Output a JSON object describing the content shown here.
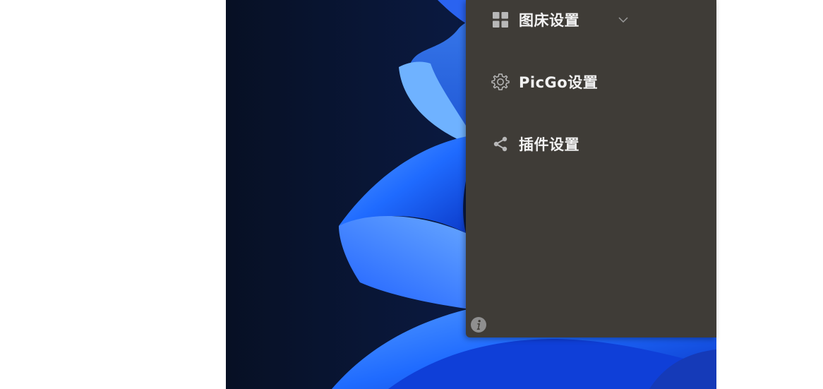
{
  "sidebar": {
    "items": [
      {
        "label": "图床设置",
        "icon": "grid-icon",
        "has_chevron": true
      },
      {
        "label": "PicGo设置",
        "icon": "gear-icon",
        "has_chevron": false
      },
      {
        "label": "插件设置",
        "icon": "share-icon",
        "has_chevron": false
      }
    ],
    "info_icon": "info-icon",
    "background_color": "#3f3c37",
    "icon_color": "#b8b8b8",
    "text_color": "#f2f2f2"
  },
  "desktop": {
    "wallpaper": "windows-11-bloom"
  }
}
